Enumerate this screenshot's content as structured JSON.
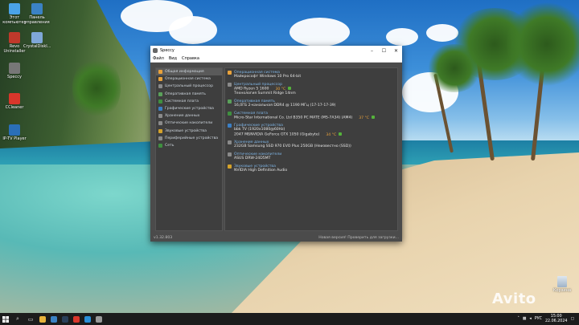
{
  "desktop": {
    "icons": [
      {
        "label": "Этот компьютер",
        "icon": "computer-icon",
        "color": "#4aa3e8"
      },
      {
        "label": "Панель управления",
        "icon": "control-panel-icon",
        "color": "#3b82c4"
      },
      {
        "label": "Revo Uninstaller",
        "icon": "revo-uninstaller-icon",
        "color": "#c0392b"
      },
      {
        "label": "CrystalDiskI...",
        "icon": "crystaldiskinfo-icon",
        "color": "#7fa7d8"
      },
      {
        "label": "Speccy",
        "icon": "speccy-icon",
        "color": "#777777"
      },
      {
        "label": "CCleaner",
        "icon": "ccleaner-icon",
        "color": "#d9362b"
      },
      {
        "label": "IP-TV Player",
        "icon": "iptv-player-icon",
        "color": "#2a6fb8"
      }
    ],
    "recycle_bin": {
      "label": "Корзина",
      "icon": "recycle-bin-icon"
    },
    "watermark": "Avito"
  },
  "window": {
    "title": "Speccy",
    "controls": {
      "minimize": "–",
      "maximize": "☐",
      "close": "✕"
    },
    "menu": [
      "Файл",
      "Вид",
      "Справка"
    ],
    "nav": [
      {
        "label": "Общая информация",
        "color": "#e9a23b",
        "active": true
      },
      {
        "label": "Операционная система",
        "color": "#e9a23b"
      },
      {
        "label": "Центральный процессор",
        "color": "#8a8a8a"
      },
      {
        "label": "Оперативная память",
        "color": "#5aa05a"
      },
      {
        "label": "Системная плата",
        "color": "#3f8f3f"
      },
      {
        "label": "Графические устройства",
        "color": "#3b7fc4"
      },
      {
        "label": "Хранение данных",
        "color": "#8a8a8a"
      },
      {
        "label": "Оптические накопители",
        "color": "#8a8a8a"
      },
      {
        "label": "Звуковые устройства",
        "color": "#d4a22b"
      },
      {
        "label": "Периферийные устройства",
        "color": "#8a8a8a"
      },
      {
        "label": "Сеть",
        "color": "#3f8f3f"
      }
    ],
    "summary": [
      {
        "heading": "Операционная система",
        "color": "#e9a23b",
        "lines": [
          {
            "text": "Майкрософт Windows 10 Pro 64-bit"
          }
        ]
      },
      {
        "heading": "Центральный процессор",
        "color": "#8a8a8a",
        "lines": [
          {
            "text": "AMD Ryzen 5 1600",
            "temp": "30 °C"
          },
          {
            "text": "Технология Summit Ridge 14nm"
          }
        ]
      },
      {
        "heading": "Оперативная память",
        "color": "#5aa05a",
        "lines": [
          {
            "text": "16,0ГБ 2-канальная DDR4 @ 1190 МГц (17-17-17-39)"
          }
        ]
      },
      {
        "heading": "Системная плата",
        "color": "#3f8f3f",
        "lines": [
          {
            "text": "Micro-Star International Co. Ltd B350 PC MATE (MS-7A34) (AM4)",
            "temp": "37 °C"
          }
        ]
      },
      {
        "heading": "Графические устройства",
        "color": "#3b7fc4",
        "lines": [
          {
            "text": "bbk TV (1920x1080@60Hz)"
          },
          {
            "text": "2047 МБNVIDIA GeForce GTX 1050 (Gigabyte)",
            "temp": "34 °C"
          }
        ]
      },
      {
        "heading": "Хранение данных",
        "color": "#8a8a8a",
        "lines": [
          {
            "text": "232GB Samsung SSD 970 EVO Plus 250GB (Неизвестно (SSD))"
          }
        ]
      },
      {
        "heading": "Оптические накопители",
        "color": "#8a8a8a",
        "lines": [
          {
            "text": "ASUS DRW-24D5MT"
          }
        ]
      },
      {
        "heading": "Звуковые устройства",
        "color": "#d4a22b",
        "lines": [
          {
            "text": "NVIDIA High Definition Audio"
          }
        ]
      }
    ],
    "status": {
      "version": "v1.32.803",
      "update": "Новая версия! Проверить для загрузки..."
    }
  },
  "taskbar": {
    "apps": [
      {
        "icon": "file-explorer-icon",
        "color": "#e8b33b"
      },
      {
        "icon": "mail-icon",
        "color": "#3b82c4"
      },
      {
        "icon": "steam-icon",
        "color": "#2a3f5a"
      },
      {
        "icon": "chrome-icon",
        "color": "#d9362b"
      },
      {
        "icon": "edge-icon",
        "color": "#2a8fd8"
      },
      {
        "icon": "speccy-icon",
        "color": "#9a9a9a"
      }
    ],
    "tray": {
      "language": "РУС",
      "time": "15:00",
      "date": "22.06.2024"
    }
  }
}
